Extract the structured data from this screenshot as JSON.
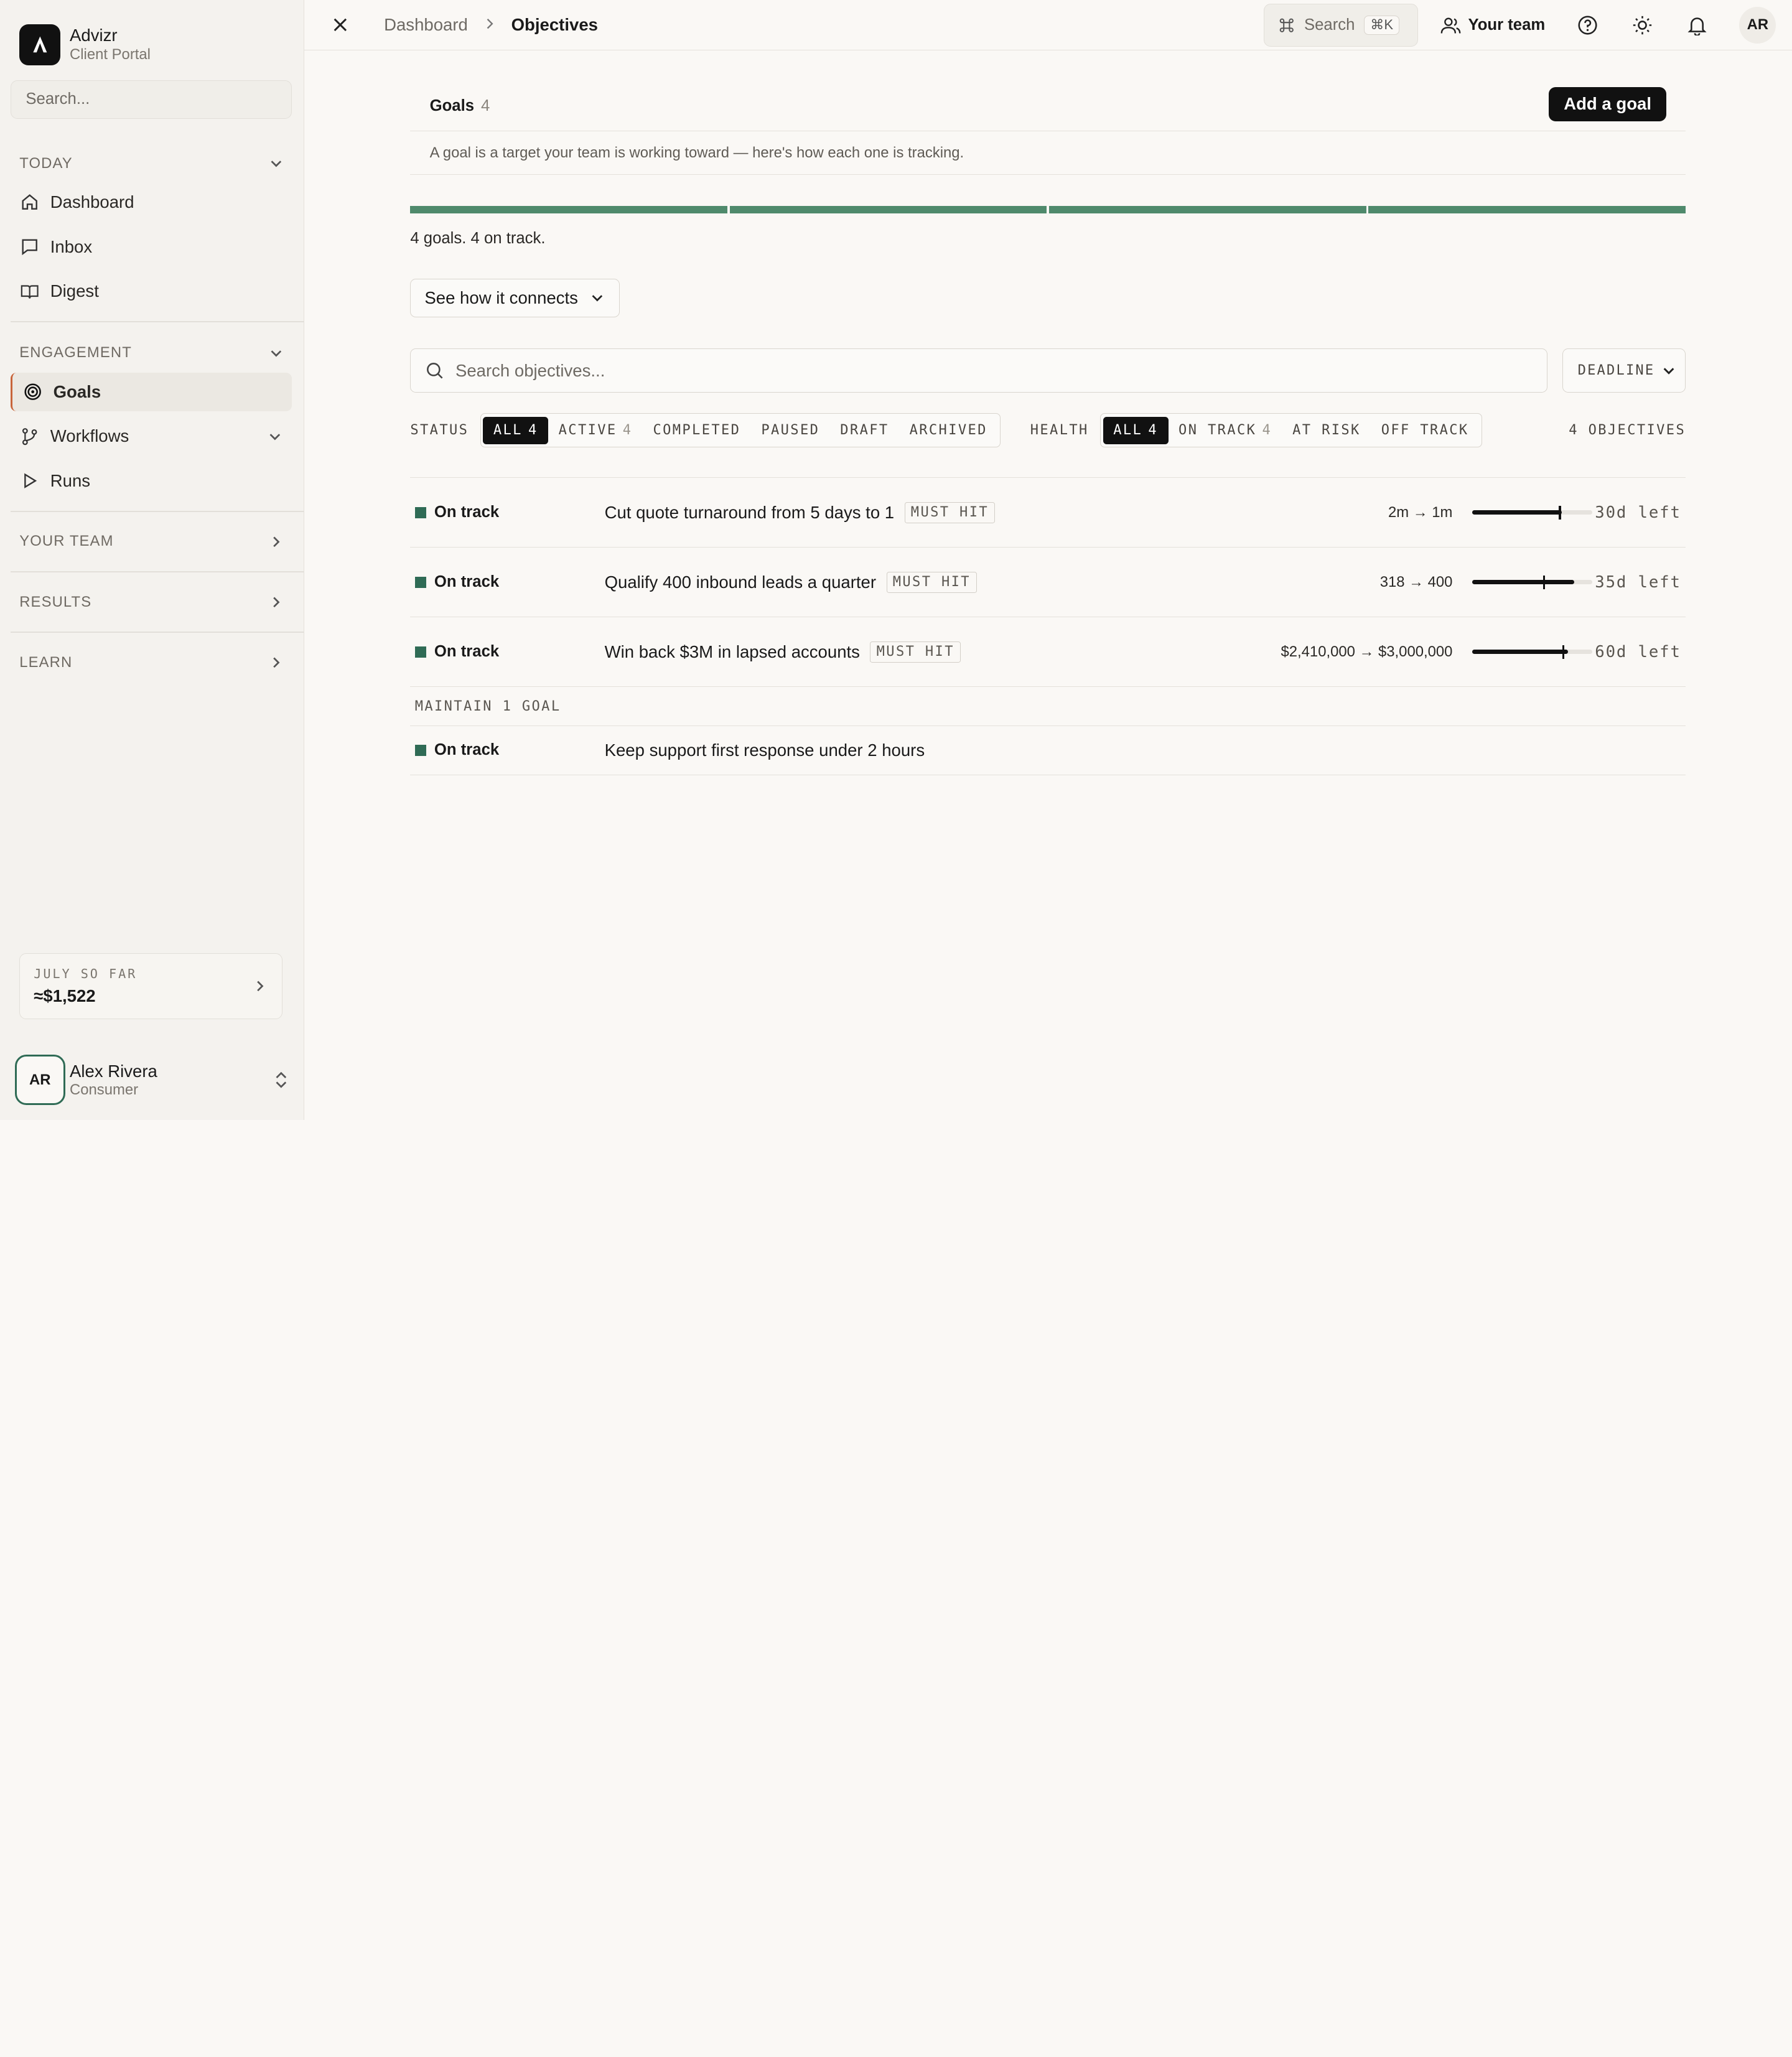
{
  "brand": {
    "name": "Advizr",
    "subtitle": "Client Portal"
  },
  "sidebar": {
    "search_placeholder": "Search...",
    "sections": {
      "today": {
        "label": "TODAY",
        "items": [
          "Dashboard",
          "Inbox",
          "Digest"
        ]
      },
      "engagement": {
        "label": "ENGAGEMENT",
        "items": [
          "Goals",
          "Workflows",
          "Runs"
        ]
      }
    },
    "collapsed": [
      "YOUR TEAM",
      "RESULTS",
      "LEARN"
    ],
    "july_card": {
      "label": "JULY SO FAR",
      "value": "≈$1,522"
    },
    "user": {
      "initials": "AR",
      "name": "Alex Rivera",
      "role": "Consumer"
    }
  },
  "topbar": {
    "breadcrumb": [
      "Dashboard",
      "Objectives"
    ],
    "search_label": "Search",
    "search_kbd": "⌘K",
    "team_label": "Your team",
    "avatar": "AR"
  },
  "goals": {
    "title": "Goals",
    "count": "4",
    "add_label": "Add a goal",
    "description": "A goal is a target your team is working toward — here's how each one is tracking.",
    "summary": "4 goals. 4 on track.",
    "connect_label": "See how it connects",
    "search_placeholder": "Search objectives...",
    "sort_label": "DEADLINE",
    "status_label": "STATUS",
    "status_filters": [
      {
        "label": "ALL",
        "n": "4"
      },
      {
        "label": "ACTIVE",
        "n": "4"
      },
      {
        "label": "COMPLETED",
        "n": ""
      },
      {
        "label": "PAUSED",
        "n": ""
      },
      {
        "label": "DRAFT",
        "n": ""
      },
      {
        "label": "ARCHIVED",
        "n": ""
      }
    ],
    "health_label": "HEALTH",
    "health_filters": [
      {
        "label": "ALL",
        "n": "4"
      },
      {
        "label": "ON TRACK",
        "n": "4"
      },
      {
        "label": "AT RISK",
        "n": ""
      },
      {
        "label": "OFF TRACK",
        "n": ""
      }
    ],
    "objectives_count": "4 OBJECTIVES",
    "rows": [
      {
        "status": "On track",
        "name": "Cut quote turnaround from 5 days to 1",
        "tag": "MUST HIT",
        "range": "2m → 1m",
        "progress": 0.75,
        "left": "30d left"
      },
      {
        "status": "On track",
        "name": "Qualify 400 inbound leads a quarter",
        "tag": "MUST HIT",
        "range": "318 → 400",
        "progress": 0.85,
        "left": "35d left"
      },
      {
        "status": "On track",
        "name": "Win back $3M in lapsed accounts",
        "tag": "MUST HIT",
        "range": "$2,410,000 → $3,000,000",
        "progress": 0.8,
        "left": "60d left"
      }
    ],
    "maintain_label": "MAINTAIN 1 GOAL",
    "maintain_rows": [
      {
        "status": "On track",
        "name": "Keep support first response under 2 hours"
      }
    ]
  }
}
